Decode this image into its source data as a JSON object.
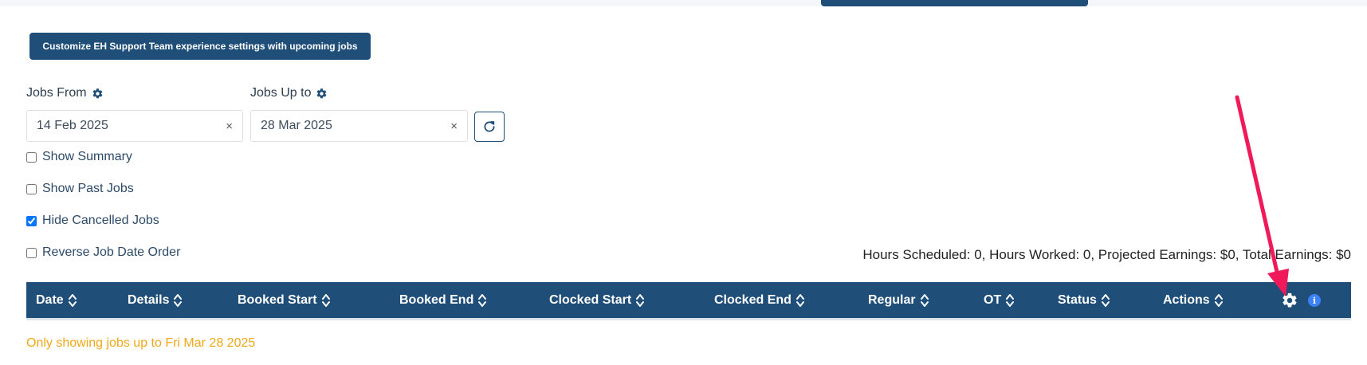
{
  "header": {
    "customize_label": "Customize EH Support Team experience settings with upcoming jobs"
  },
  "filters": {
    "jobs_from": {
      "label": "Jobs From",
      "value": "14 Feb 2025",
      "clear": "×"
    },
    "jobs_up_to": {
      "label": "Jobs Up to",
      "value": "28 Mar 2025",
      "clear": "×"
    }
  },
  "options": [
    {
      "label": "Show Summary",
      "checked": false
    },
    {
      "label": "Show Past Jobs",
      "checked": false
    },
    {
      "label": "Hide Cancelled Jobs",
      "checked": true
    },
    {
      "label": "Reverse Job Date Order",
      "checked": false
    }
  ],
  "totals": "Hours Scheduled: 0, Hours Worked: 0, Projected Earnings: $0, Total Earnings: $0",
  "table": {
    "columns": [
      "Date",
      "Details",
      "Booked Start",
      "Booked End",
      "Clocked Start",
      "Clocked End",
      "Regular",
      "OT",
      "Status",
      "Actions"
    ],
    "info_glyph": "i"
  },
  "notice": "Only showing jobs up to Fri Mar 28 2025",
  "colors": {
    "primary": "#1f4e79",
    "notice": "#f0a818",
    "info": "#3b82f6",
    "annotation_arrow": "#f0195a"
  },
  "icons": {
    "settings": "gear-icon",
    "refresh": "refresh-icon",
    "sort": "sort-icon",
    "info": "info-icon",
    "annotation": "arrow-annotation"
  }
}
